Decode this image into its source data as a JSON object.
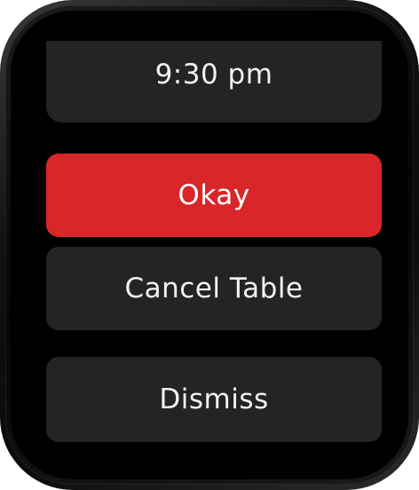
{
  "header": {
    "time": "9:30 pm"
  },
  "actions": {
    "okay_label": "Okay",
    "cancel_label": "Cancel Table",
    "dismiss_label": "Dismiss"
  },
  "colors": {
    "accent": "#d9262a",
    "button_bg": "#242426",
    "screen_bg": "#000000"
  }
}
